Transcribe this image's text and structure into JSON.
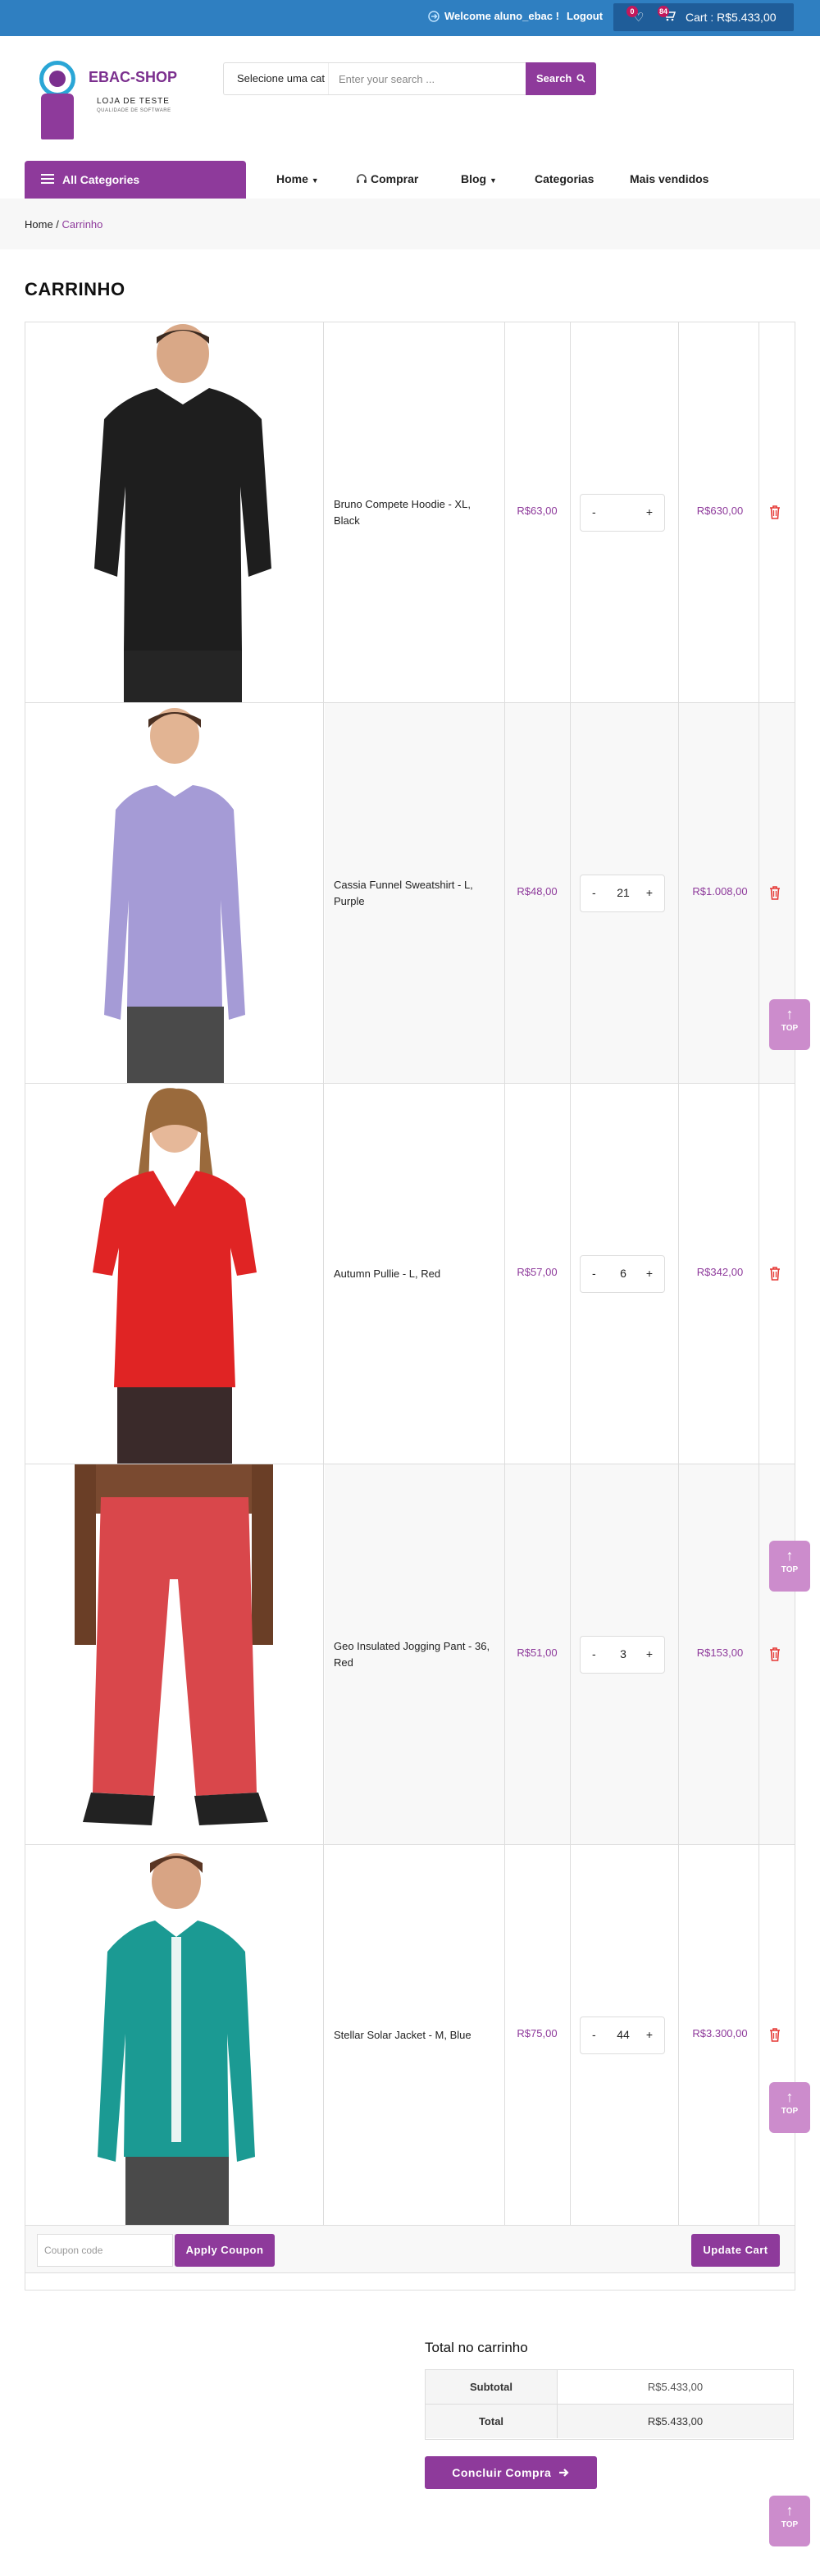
{
  "topbar": {
    "welcome": "Welcome aluno_ebac !",
    "logout": "Logout",
    "wishlist_count": "0",
    "cart_count": "84",
    "cart_label": "Cart : R$5.433,00"
  },
  "logo": {
    "brand": "EBAC-SHOP",
    "line1": "LOJA DE TESTE",
    "line2": "QUALIDADE DE SOFTWARE"
  },
  "search": {
    "category": "Selecione uma cat",
    "placeholder": "Enter your search ...",
    "button": "Search"
  },
  "nav": {
    "all_categories": "All Categories",
    "items": [
      "Home",
      "Comprar",
      "Blog",
      "Categorias",
      "Mais vendidos"
    ]
  },
  "breadcrumb": {
    "home": "Home",
    "separator": " / ",
    "current": "Carrinho"
  },
  "page_title": "CARRINHO",
  "cart": {
    "items": [
      {
        "name": "Bruno Compete Hoodie - XL, Black",
        "price": "R$63,00",
        "qty": "",
        "subtotal": "R$630,00",
        "garment_color": "#1e1e1e"
      },
      {
        "name": "Cassia Funnel Sweatshirt - L, Purple",
        "price": "R$48,00",
        "qty": "21",
        "subtotal": "R$1.008,00",
        "garment_color": "#a59bd6"
      },
      {
        "name": "Autumn Pullie - L, Red",
        "price": "R$57,00",
        "qty": "6",
        "subtotal": "R$342,00",
        "garment_color": "#e02424"
      },
      {
        "name": "Geo Insulated Jogging Pant - 36, Red",
        "price": "R$51,00",
        "qty": "3",
        "subtotal": "R$153,00",
        "garment_color": "#d9474b"
      },
      {
        "name": "Stellar Solar Jacket - M, Blue",
        "price": "R$75,00",
        "qty": "44",
        "subtotal": "R$3.300,00",
        "garment_color": "#1b9a93"
      }
    ],
    "coupon_placeholder": "Coupon code",
    "apply_coupon": "Apply Coupon",
    "update_cart": "Update Cart"
  },
  "totals": {
    "title": "Total no carrinho",
    "subtotal_label": "Subtotal",
    "subtotal_value": "R$5.433,00",
    "total_label": "Total",
    "total_value": "R$5.433,00",
    "checkout": "Concluir Compra"
  },
  "scroll_top_label": "TOP",
  "colors": {
    "accent": "#8e3a9b",
    "topbar": "#2f7fc1",
    "scroll_top": "#cc8ccc"
  }
}
